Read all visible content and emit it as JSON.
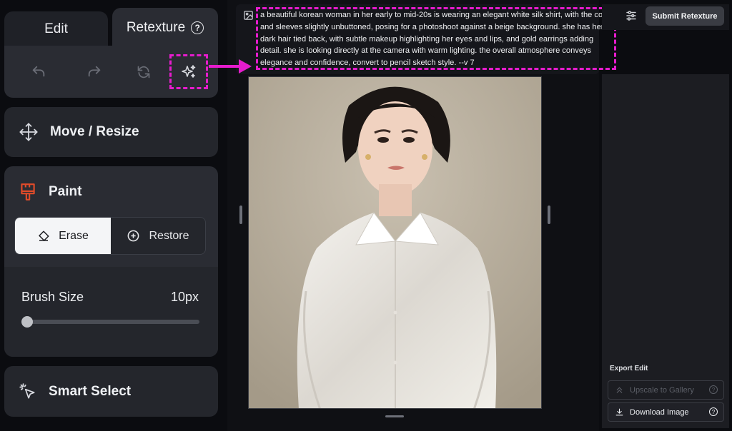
{
  "tabs": {
    "edit": "Edit",
    "retexture": "Retexture",
    "help_glyph": "?"
  },
  "toolbar": {
    "icons": [
      "undo-icon",
      "redo-icon",
      "refresh-icon",
      "sparkle-icon"
    ]
  },
  "tools": {
    "move_resize": "Move / Resize",
    "paint": "Paint",
    "erase": "Erase",
    "restore": "Restore",
    "brush_size_label": "Brush Size",
    "brush_size_value": "10px",
    "brush_size_level": 0.0,
    "smart_select": "Smart Select"
  },
  "prompt": {
    "text": "a beautiful korean woman in her early to mid-20s is wearing an elegant white silk shirt, with the collar and sleeves slightly unbuttoned, posing for a photoshoot against a beige background. she has her dark hair tied back, with subtle makeup highlighting her eyes and lips, and gold earrings adding detail. she is looking directly at the camera with warm lighting. the overall atmosphere conveys elegance and confidence, convert to pencil sketch style. --v 7"
  },
  "header": {
    "submit": "Submit Retexture"
  },
  "export": {
    "label": "Export Edit",
    "upscale": "Upscale to Gallery",
    "download": "Download Image",
    "help_glyph": "?"
  },
  "colors": {
    "highlight": "#e61ccd",
    "paint_icon": "#e04b2a"
  }
}
